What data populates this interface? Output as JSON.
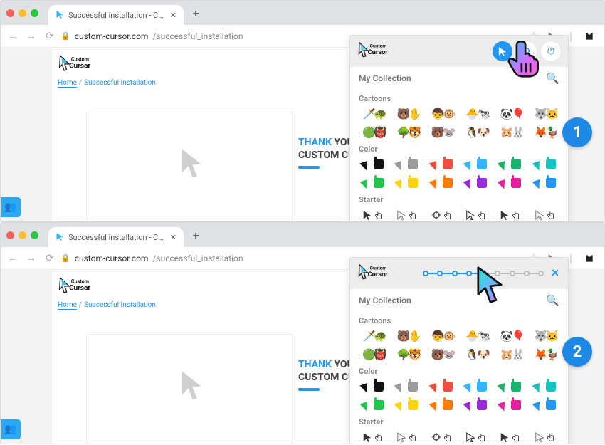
{
  "browser": {
    "tab_title": "Successful installation - Custom",
    "url_host": "custom-cursor.com",
    "url_path": "/successful_installation"
  },
  "page": {
    "brand": "Custom Cursor",
    "crumb_home": "Home",
    "crumb_sep": "/",
    "crumb_installed": "Successful Installation",
    "thank_blue": "THANK",
    "thank_rest1": " YOU ",
    "thank_line2": "CUSTOM CUR"
  },
  "popup": {
    "collection_label": "My Collection",
    "cat_cartoons": "Cartoons",
    "cat_color": "Color",
    "cat_starter": "Starter"
  },
  "cartoons_row1": [
    "🗡️",
    "🐢",
    "🐻",
    "✋",
    "👦",
    "🐵",
    "🐣",
    "🐄",
    "🐼",
    "🎈",
    "🐺",
    "🐱"
  ],
  "cartoons_row2": [
    "🟢",
    "👹",
    "🌳",
    "🐯",
    "🐻",
    "🐭",
    "🐧",
    "🐶",
    "🐹",
    "🐰",
    "🦊",
    "🦆"
  ],
  "colors": [
    {
      "c": "#111"
    },
    {
      "c": "#9c9c9c"
    },
    {
      "c": "#f04e3e"
    },
    {
      "c": "#31b6ff"
    },
    {
      "c": "#19b36b"
    },
    {
      "c": "#15c1c1"
    },
    {
      "c": "#1ec74b"
    },
    {
      "c": "#ffd400"
    },
    {
      "c": "#ff7a00"
    },
    {
      "c": "#9b2bd8"
    },
    {
      "c": "#e81ea0"
    },
    {
      "c": "#2196f3"
    }
  ],
  "badges": {
    "one": "1",
    "two": "2"
  },
  "slider": {
    "steps": 9,
    "active_index": 4
  }
}
